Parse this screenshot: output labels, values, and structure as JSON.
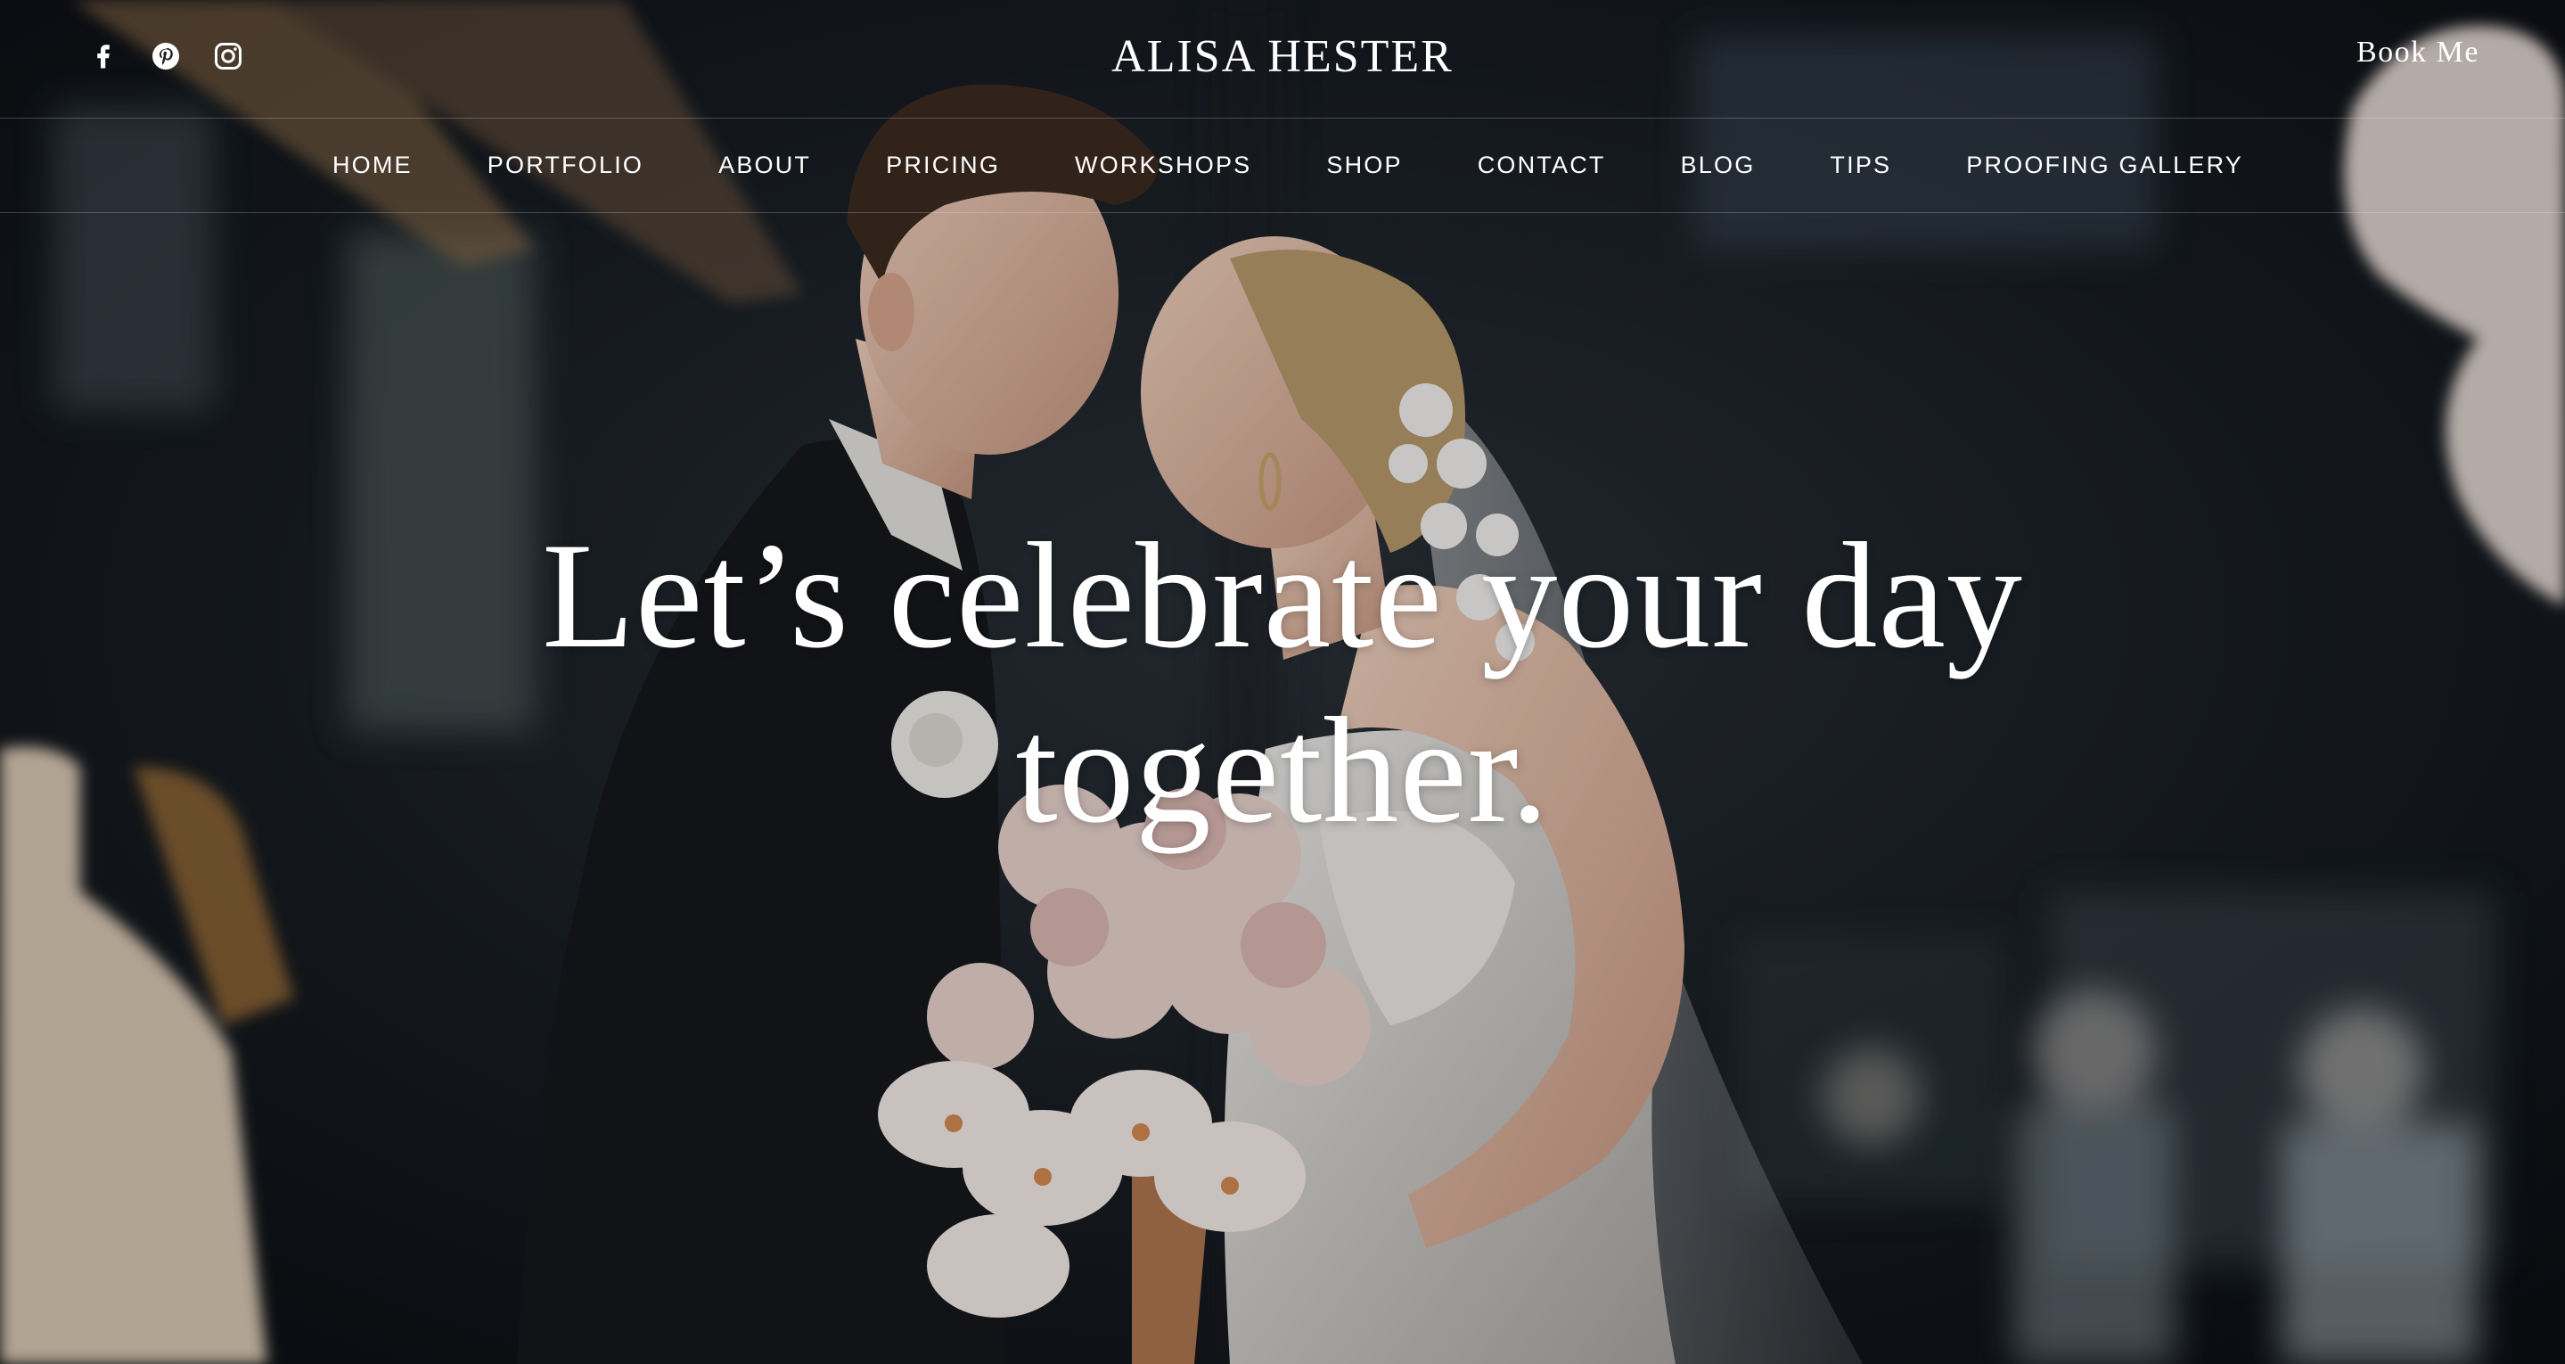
{
  "header": {
    "brand": "ALISA HESTER",
    "book_label": "Book Me",
    "social": [
      {
        "icon": "facebook-icon"
      },
      {
        "icon": "pinterest-icon"
      },
      {
        "icon": "instagram-icon"
      }
    ]
  },
  "nav": {
    "items": [
      {
        "label": "HOME"
      },
      {
        "label": "PORTFOLIO"
      },
      {
        "label": "ABOUT"
      },
      {
        "label": "PRICING"
      },
      {
        "label": "WORKSHOPS"
      },
      {
        "label": "SHOP"
      },
      {
        "label": "CONTACT"
      },
      {
        "label": "BLOG"
      },
      {
        "label": "TIPS"
      },
      {
        "label": "PROOFING GALLERY"
      }
    ]
  },
  "hero": {
    "headline_line1": "Let’s celebrate your day",
    "headline_line2": "together.",
    "image_subject": "bride-and-groom-kiss-photo"
  },
  "colors": {
    "text": "#ffffff",
    "overlay": "#10141a",
    "bouquet_blush": "#e8cfc8",
    "suit": "#1a1d22",
    "gown": "#dcd9d6"
  }
}
